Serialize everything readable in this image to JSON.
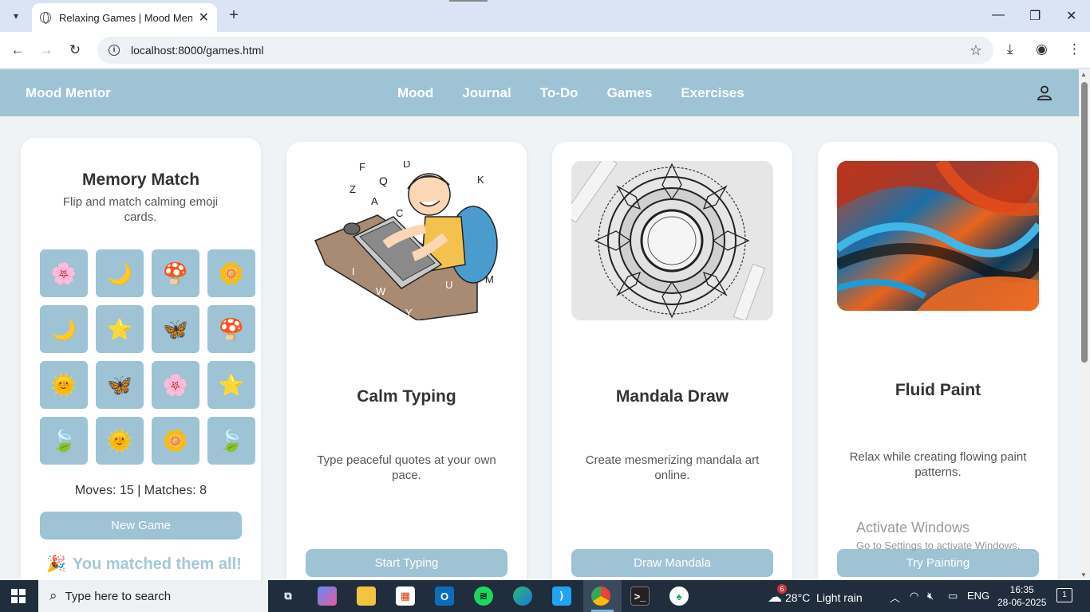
{
  "browser": {
    "tab_title": "Relaxing Games | Mood Mentor",
    "url": "localhost:8000/games.html"
  },
  "nav": {
    "brand": "Mood Mentor",
    "links": [
      "Mood",
      "Journal",
      "To-Do",
      "Games",
      "Exercises"
    ]
  },
  "memory": {
    "title": "Memory Match",
    "subtitle": "Flip and match calming emoji cards.",
    "tiles": [
      "🌸",
      "🌙",
      "🍄",
      "🌼",
      "🌙",
      "⭐",
      "🦋",
      "🍄",
      "🌞",
      "🦋",
      "🌸",
      "⭐",
      "🍃",
      "🌞",
      "🌼",
      "🍃"
    ],
    "moves_label": "Moves:",
    "moves": "15",
    "separator": "|",
    "matches_label": "Matches:",
    "matches": "8",
    "new_game": "New Game",
    "win_icon": "🎉",
    "win_text": "You matched them all!"
  },
  "games": [
    {
      "title": "Calm Typing",
      "desc": "Type peaceful quotes at your own pace.",
      "button": "Start Typing"
    },
    {
      "title": "Mandala Draw",
      "desc": "Create mesmerizing mandala art online.",
      "button": "Draw Mandala"
    },
    {
      "title": "Fluid Paint",
      "desc": "Relax while creating flowing paint patterns.",
      "button": "Try Painting"
    }
  ],
  "typing_letters": [
    "F",
    "D",
    "K",
    "Z",
    "Q",
    "A",
    "C",
    "I",
    "W",
    "U",
    "M",
    "Y"
  ],
  "watermark": {
    "line1": "Activate Windows",
    "line2": "Go to Settings to activate Windows."
  },
  "taskbar": {
    "search_placeholder": "Type here to search",
    "weather_badge": "6",
    "weather": "28°C  Light rain",
    "lang": "ENG",
    "time": "16:35",
    "date": "28-06-2025",
    "notif_count": "1"
  }
}
